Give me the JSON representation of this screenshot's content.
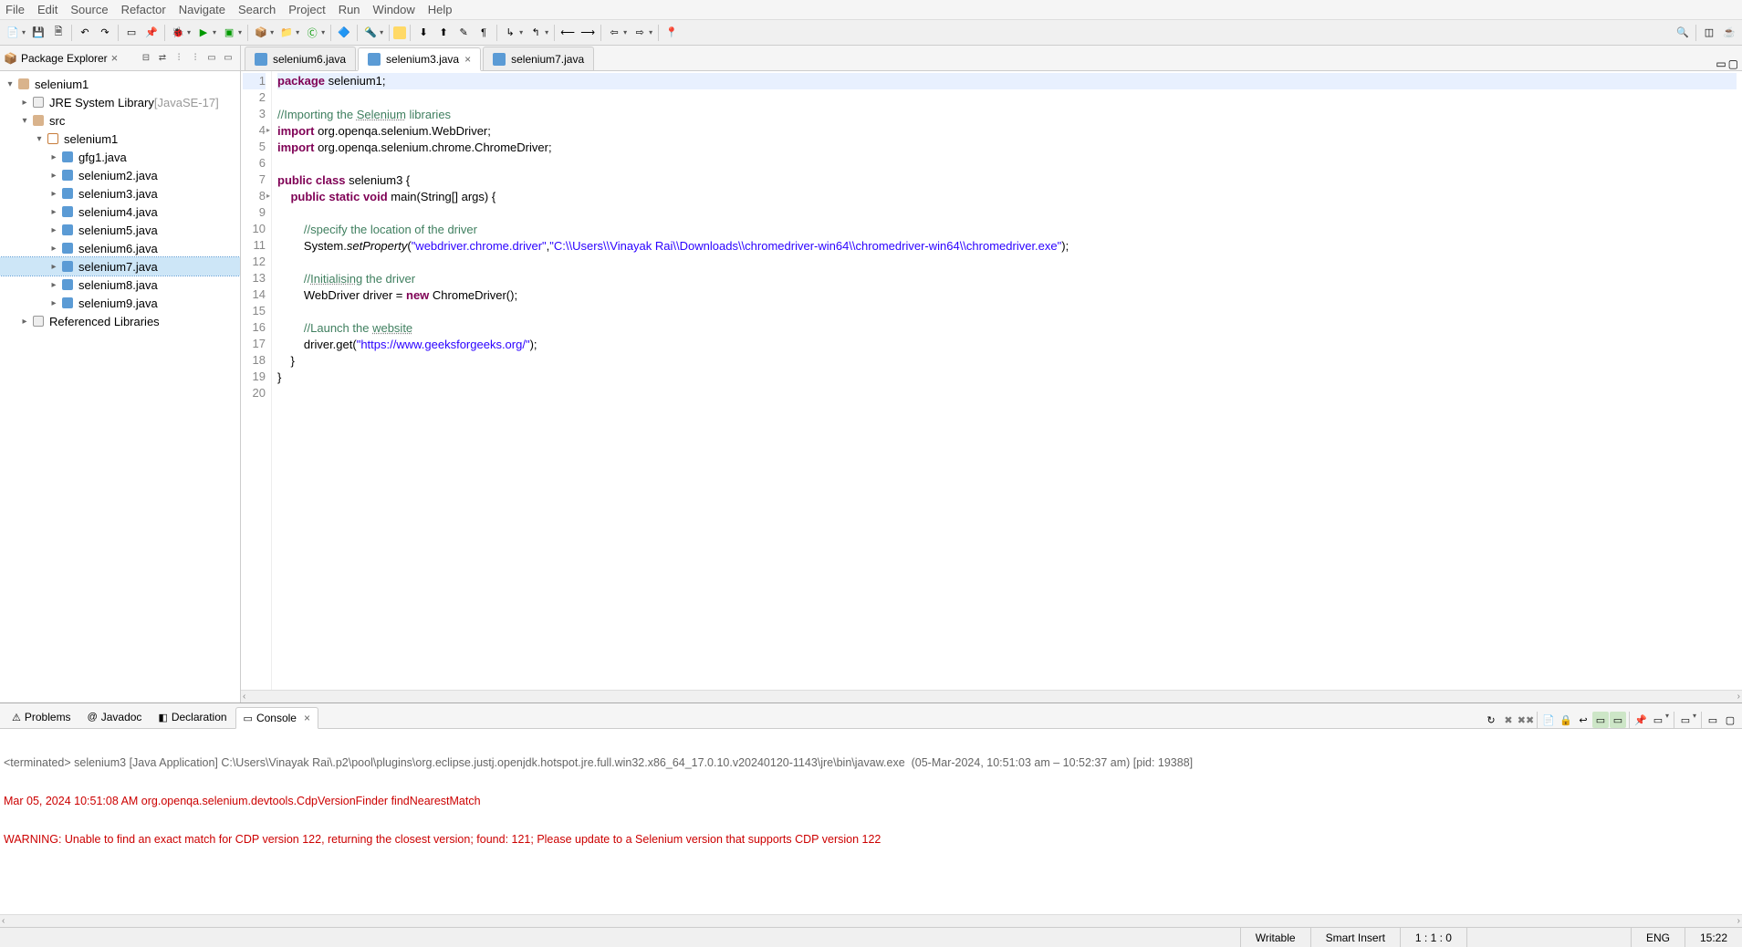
{
  "menu": [
    "File",
    "Edit",
    "Source",
    "Refactor",
    "Navigate",
    "Search",
    "Project",
    "Run",
    "Window",
    "Help"
  ],
  "package_explorer": {
    "title": "Package Explorer",
    "project": "selenium1",
    "jre_label": "JRE System Library",
    "jre_version": "[JavaSE-17]",
    "src": "src",
    "pkg": "selenium1",
    "files": [
      "gfg1.java",
      "selenium2.java",
      "selenium3.java",
      "selenium4.java",
      "selenium5.java",
      "selenium6.java",
      "selenium7.java",
      "selenium8.java",
      "selenium9.java"
    ],
    "selected": "selenium7.java",
    "ref_libs": "Referenced Libraries"
  },
  "editor": {
    "tabs": [
      {
        "label": "selenium6.java",
        "active": false,
        "closeable": false
      },
      {
        "label": "selenium3.java",
        "active": true,
        "closeable": true
      },
      {
        "label": "selenium7.java",
        "active": false,
        "closeable": false
      }
    ],
    "code_lines": [
      {
        "n": 1,
        "hl": true,
        "html": "<span class='kw'>package</span> selenium1;"
      },
      {
        "n": 2,
        "html": ""
      },
      {
        "n": 3,
        "html": "<span class='cm'>//Importing the <span class='ul'>Selenium</span> libraries</span>"
      },
      {
        "n": 4,
        "imp": true,
        "html": "<span class='kw'>import</span> org.openqa.selenium.WebDriver;"
      },
      {
        "n": 5,
        "html": "<span class='kw'>import</span> org.openqa.selenium.chrome.ChromeDriver;"
      },
      {
        "n": 6,
        "html": ""
      },
      {
        "n": 7,
        "html": "<span class='kw'>public</span> <span class='kw'>class</span> selenium3 {"
      },
      {
        "n": 8,
        "imp": true,
        "html": "    <span class='kw'>public</span> <span class='kw'>static</span> <span class='kw'>void</span> main(String[] args) {"
      },
      {
        "n": 9,
        "html": ""
      },
      {
        "n": 10,
        "html": "        <span class='cm'>//specify the location of the driver</span>"
      },
      {
        "n": 11,
        "html": "        System.<span class='it'>setProperty</span>(<span class='str'>\"webdriver.chrome.driver\"</span>,<span class='str'>\"C:\\\\Users\\\\Vinayak Rai\\\\Downloads\\\\chromedriver-win64\\\\chromedriver-win64\\\\chromedriver.exe\"</span>);"
      },
      {
        "n": 12,
        "html": ""
      },
      {
        "n": 13,
        "html": "        <span class='cm'>//<span class='ul'>Initialising</span> the driver</span>"
      },
      {
        "n": 14,
        "html": "        WebDriver driver = <span class='kw'>new</span> ChromeDriver();"
      },
      {
        "n": 15,
        "html": ""
      },
      {
        "n": 16,
        "html": "        <span class='cm'>//Launch the <span class='ul'>website</span></span>"
      },
      {
        "n": 17,
        "html": "        driver.get(<span class='str'>\"https://www.geeksforgeeks.org/\"</span>);"
      },
      {
        "n": 18,
        "html": "    }"
      },
      {
        "n": 19,
        "html": "}"
      },
      {
        "n": 20,
        "html": ""
      }
    ]
  },
  "bottom": {
    "tabs": [
      "Problems",
      "Javadoc",
      "Declaration",
      "Console"
    ],
    "active": "Console",
    "term_header": "<terminated> selenium3 [Java Application] C:\\Users\\Vinayak Rai\\.p2\\pool\\plugins\\org.eclipse.justj.openjdk.hotspot.jre.full.win32.x86_64_17.0.10.v20240120-1143\\jre\\bin\\javaw.exe  (05-Mar-2024, 10:51:03 am – 10:52:37 am) [pid: 19388]",
    "line1": "Mar 05, 2024 10:51:08 AM org.openqa.selenium.devtools.CdpVersionFinder findNearestMatch",
    "line2": "WARNING: Unable to find an exact match for CDP version 122, returning the closest version; found: 121; Please update to a Selenium version that supports CDP version 122"
  },
  "status": {
    "writable": "Writable",
    "insert": "Smart Insert",
    "pos": "1 : 1 : 0",
    "lang": "ENG",
    "time": "15:22"
  }
}
